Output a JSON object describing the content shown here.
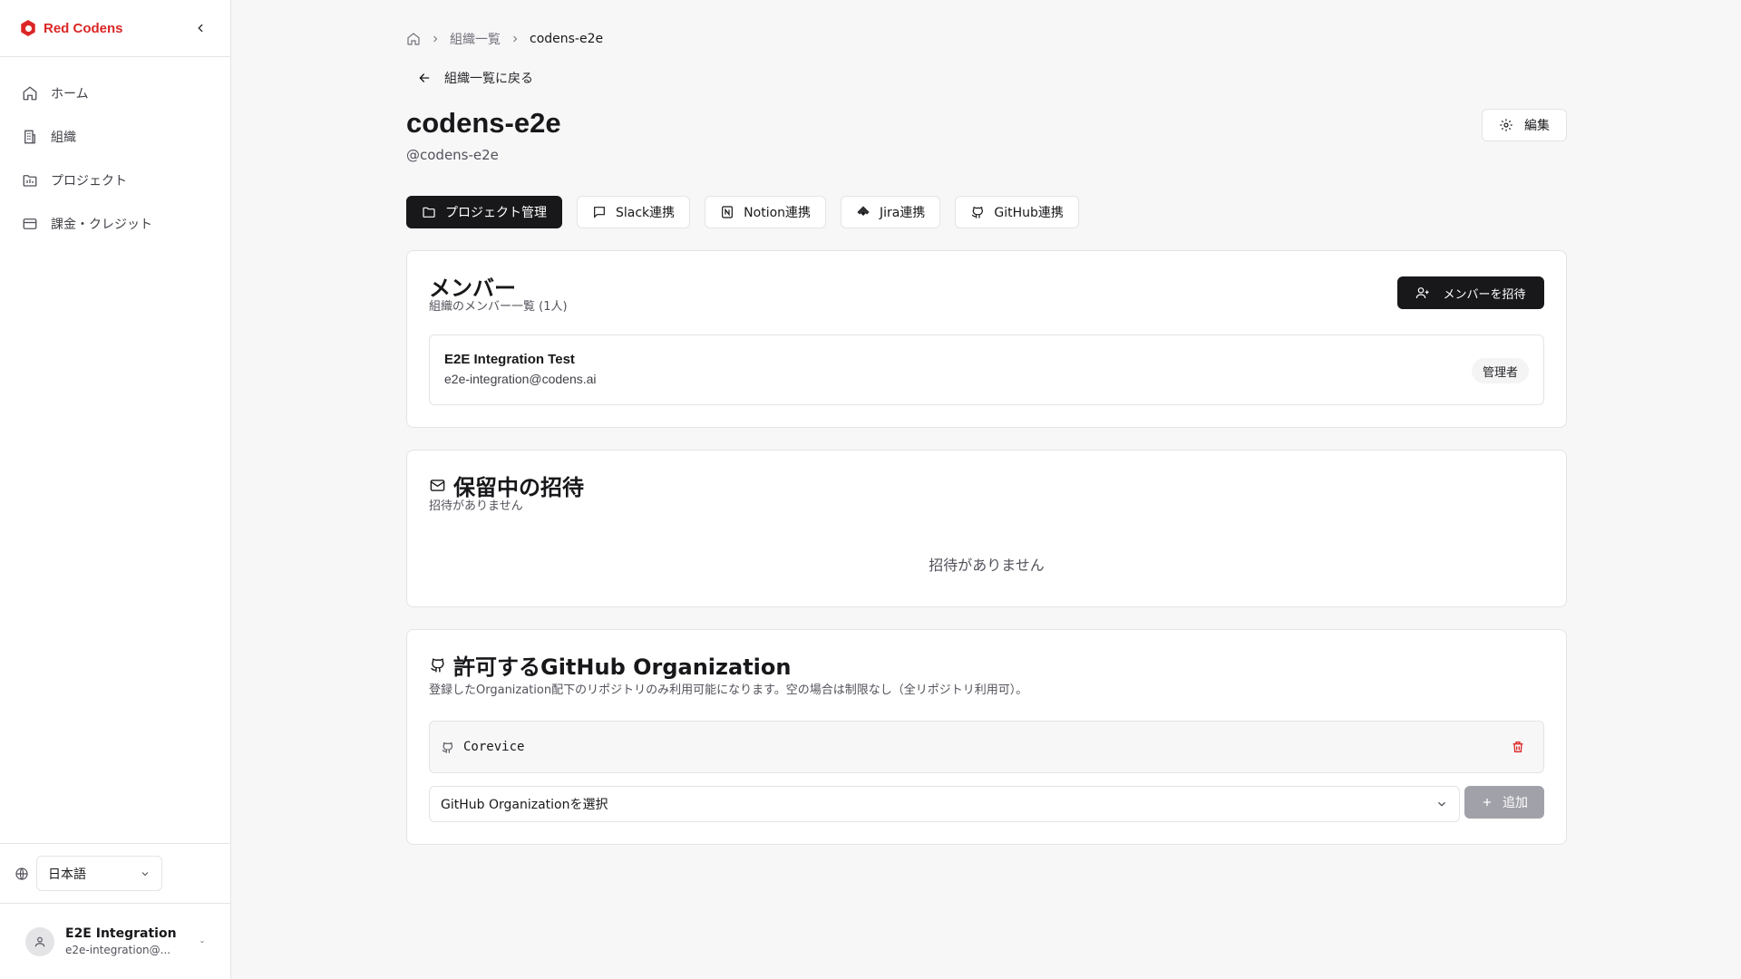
{
  "sidebar": {
    "brand": "Red Codens",
    "items": [
      {
        "label": "ホーム",
        "icon": "home-icon"
      },
      {
        "label": "組織",
        "icon": "building-icon"
      },
      {
        "label": "プロジェクト",
        "icon": "folder-icon"
      },
      {
        "label": "課金・クレジット",
        "icon": "credit-card-icon"
      }
    ],
    "language": "日本語",
    "user": {
      "name": "E2E Integration ...",
      "email": "e2e-integration@..."
    }
  },
  "breadcrumb": {
    "root_icon": "home-icon",
    "parent": "組織一覧",
    "current": "codens-e2e"
  },
  "back_link": "組織一覧に戻る",
  "org": {
    "name": "codens-e2e",
    "handle": "@codens-e2e"
  },
  "edit_button": "編集",
  "tabs": [
    {
      "label": "プロジェクト管理",
      "icon": "folder-icon"
    },
    {
      "label": "Slack連携",
      "icon": "message-icon"
    },
    {
      "label": "Notion連携",
      "icon": "notion-icon"
    },
    {
      "label": "Jira連携",
      "icon": "jira-icon"
    },
    {
      "label": "GitHub連携",
      "icon": "github-icon"
    }
  ],
  "members": {
    "title": "メンバー",
    "subtitle": "組織のメンバー一覧 (1人)",
    "invite_button": "メンバーを招待",
    "rows": [
      {
        "name": "E2E Integration Test",
        "email": "e2e-integration@codens.ai",
        "role": "管理者"
      }
    ]
  },
  "invites": {
    "title": "保留中の招待",
    "subtitle": "招待がありません",
    "empty": "招待がありません"
  },
  "github": {
    "title": "許可するGitHub Organization",
    "subtitle": "登録したOrganization配下のリポジトリのみ利用可能になります。空の場合は制限なし（全リポジトリ利用可）。",
    "orgs": [
      "Corevice"
    ],
    "select_placeholder": "GitHub Organizationを選択",
    "add_button": "追加"
  },
  "colors": {
    "brand": "#dc2626",
    "primary": "#18181b",
    "delete": "#dc2626",
    "disabled": "#a1a1aa"
  }
}
